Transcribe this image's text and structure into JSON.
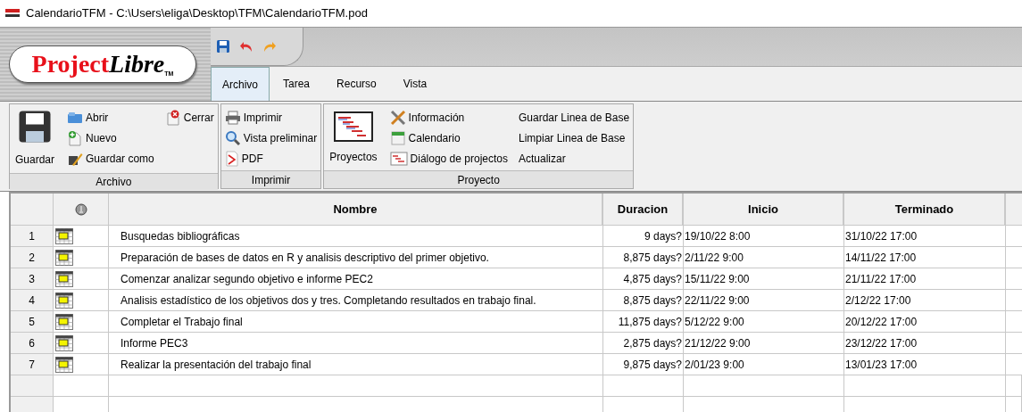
{
  "window": {
    "title": "CalendarioTFM - C:\\Users\\eliga\\Desktop\\TFM\\CalendarioTFM.pod"
  },
  "logo": {
    "primary": "Project",
    "secondary": "Libre",
    "mark": "TM"
  },
  "tabs": [
    {
      "label": "Archivo",
      "selected": true
    },
    {
      "label": "Tarea",
      "selected": false
    },
    {
      "label": "Recurso",
      "selected": false
    },
    {
      "label": "Vista",
      "selected": false
    }
  ],
  "ribbon": {
    "groups": [
      {
        "label": "Archivo",
        "big": "Guardar",
        "columns": [
          [
            "Abrir",
            "Nuevo",
            "Guardar como"
          ],
          [
            "Cerrar"
          ]
        ]
      },
      {
        "label": "Imprimir",
        "columns": [
          [
            "Imprimir",
            "Vista preliminar",
            "PDF"
          ]
        ]
      },
      {
        "label": "Proyecto",
        "big": "Proyectos",
        "columns": [
          [
            "Información",
            "Calendario",
            "Diálogo de projectos"
          ],
          [
            "Guardar Linea de Base",
            "Limpiar Linea de Base",
            "Actualizar"
          ]
        ]
      }
    ]
  },
  "table": {
    "columns": [
      "Nombre",
      "Duracion",
      "Inicio",
      "Terminado"
    ],
    "rows": [
      {
        "number": "1",
        "name": "Busquedas bibliográficas",
        "duration": "9 days?",
        "start": "19/10/22 8:00",
        "finish": "31/10/22 17:00"
      },
      {
        "number": "2",
        "name": "Preparación de bases de datos en R y analisis descriptivo del primer objetivo.",
        "duration": "8,875 days?",
        "start": "2/11/22 9:00",
        "finish": "14/11/22 17:00"
      },
      {
        "number": "3",
        "name": "Comenzar analizar segundo objetivo e informe PEC2",
        "duration": "4,875 days?",
        "start": "15/11/22 9:00",
        "finish": "21/11/22 17:00"
      },
      {
        "number": "4",
        "name": "Analisis estadístico de los objetivos dos y tres. Completando resultados en trabajo final.",
        "duration": "8,875 days?",
        "start": "22/11/22 9:00",
        "finish": "2/12/22 17:00"
      },
      {
        "number": "5",
        "name": "Completar el Trabajo final",
        "duration": "11,875 days?",
        "start": "5/12/22 9:00",
        "finish": "20/12/22 17:00"
      },
      {
        "number": "6",
        "name": "Informe PEC3",
        "duration": "2,875 days?",
        "start": "21/12/22 9:00",
        "finish": "23/12/22 17:00"
      },
      {
        "number": "7",
        "name": "Realizar la presentación del trabajo final",
        "duration": "9,875 days?",
        "start": "2/01/23 9:00",
        "finish": "13/01/23 17:00"
      }
    ]
  }
}
